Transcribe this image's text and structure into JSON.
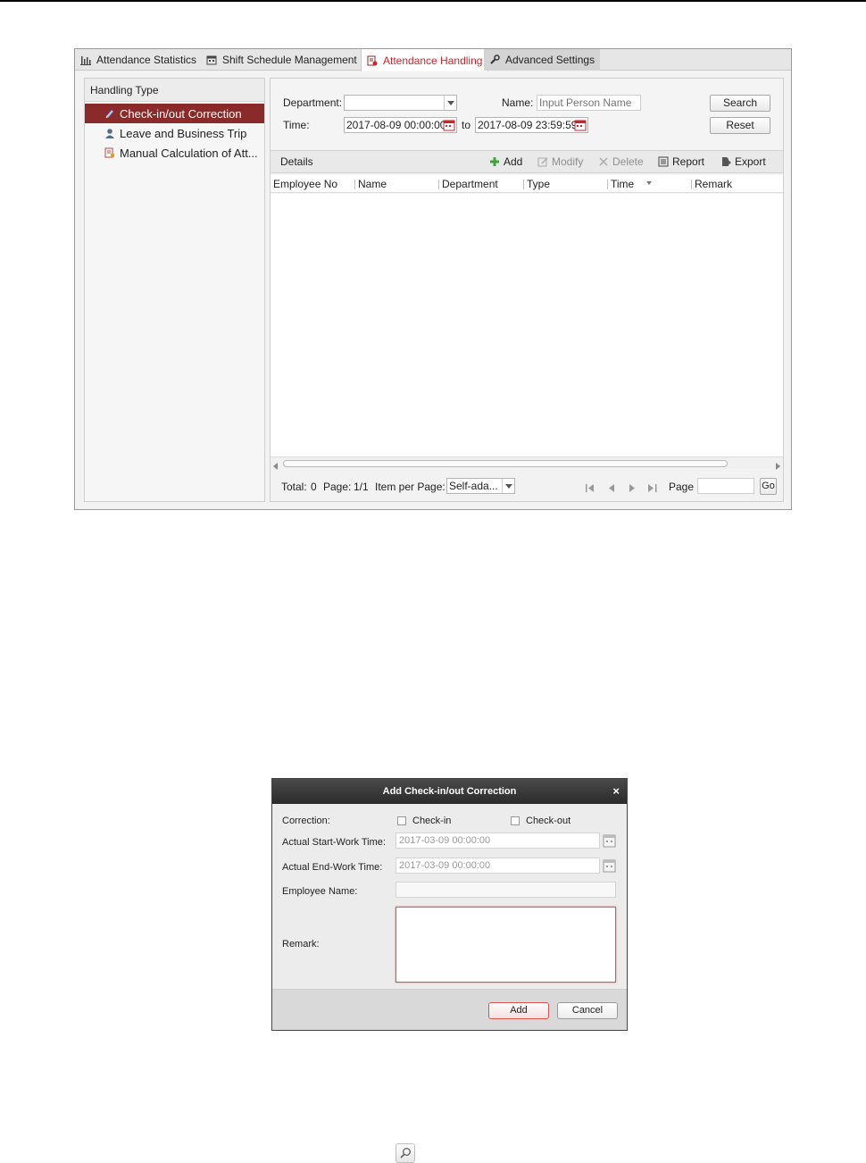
{
  "tabs": [
    {
      "label": "Attendance Statistics",
      "icon": "bar-chart-icon"
    },
    {
      "label": "Shift Schedule Management",
      "icon": "calendar-icon"
    },
    {
      "label": "Attendance Handling",
      "icon": "attendance-handling-icon",
      "active": true
    },
    {
      "label": "Advanced Settings",
      "icon": "wrench-icon"
    }
  ],
  "sidebar": {
    "header": "Handling Type",
    "items": [
      {
        "label": "Check-in/out Correction",
        "icon": "pencil-icon",
        "selected": true
      },
      {
        "label": "Leave and Business Trip",
        "icon": "person-icon"
      },
      {
        "label": "Manual Calculation of Att...",
        "icon": "manual-calculation-icon"
      }
    ]
  },
  "filters": {
    "department_label": "Department:",
    "department_value": "",
    "name_label": "Name:",
    "name_placeholder": "Input Person Name",
    "time_label": "Time:",
    "time_from": "2017-08-09 00:00:00",
    "to_label": "to",
    "time_to": "2017-08-09 23:59:59",
    "search_label": "Search",
    "reset_label": "Reset"
  },
  "details": {
    "title": "Details",
    "add": "Add",
    "modify": "Modify",
    "delete": "Delete",
    "report": "Report",
    "export": "Export"
  },
  "table": {
    "columns": [
      "Employee No",
      "Name",
      "Department",
      "Type",
      "Time",
      "Remark"
    ],
    "rows": []
  },
  "pagination": {
    "total_label": "Total:",
    "total_value": "0",
    "page_label": "Page:",
    "page_value": "1/1",
    "items_label": "Item per Page:",
    "items_value": "Self-ada...",
    "goto_label": "Page",
    "goto_value": "",
    "go_label": "Go"
  },
  "dialog": {
    "title": "Add Check-in/out Correction",
    "close": "×",
    "correction_label": "Correction:",
    "checkin_label": "Check-in",
    "checkout_label": "Check-out",
    "start_label": "Actual Start-Work Time:",
    "start_value": "2017-03-09 00:00:00",
    "end_label": "Actual End-Work Time:",
    "end_value": "2017-03-09 00:00:00",
    "employee_label": "Employee Name:",
    "employee_value": "",
    "remark_label": "Remark:",
    "remark_value": "",
    "add_label": "Add",
    "cancel_label": "Cancel"
  },
  "colors": {
    "accent": "#c8262b",
    "selected_row": "#8b2a2a",
    "dialog_title": "#2b2b2b"
  }
}
